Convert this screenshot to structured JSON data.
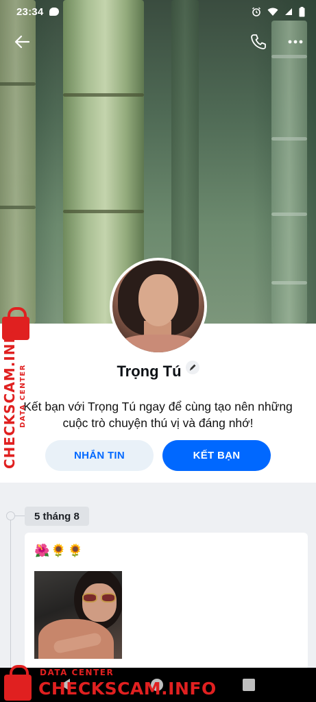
{
  "status_bar": {
    "time": "23:34",
    "icons": [
      "message-icon",
      "alarm-icon",
      "wifi-icon",
      "signal-icon",
      "battery-icon"
    ]
  },
  "top_bar": {
    "icons": [
      "back-arrow-icon",
      "phone-icon",
      "more-options-icon"
    ]
  },
  "profile": {
    "name": "Trọng Tú",
    "intro": "Kết bạn với Trọng Tú ngay để cùng tạo nên những cuộc trò chuyện thú vị và đáng nhớ!",
    "message_button": "NHẮN TIN",
    "add_friend_button": "KẾT BẠN"
  },
  "timeline": {
    "date": "5 tháng 8",
    "post": {
      "emojis": "🌺🌻🌻"
    }
  },
  "watermark": {
    "brand": "CHECKSCAM.INFO",
    "sub": "DATA CENTER"
  },
  "colors": {
    "accent": "#0068ff",
    "accent_light": "#e9f1f8",
    "watermark": "#e02020",
    "background": "#eef0f3"
  }
}
